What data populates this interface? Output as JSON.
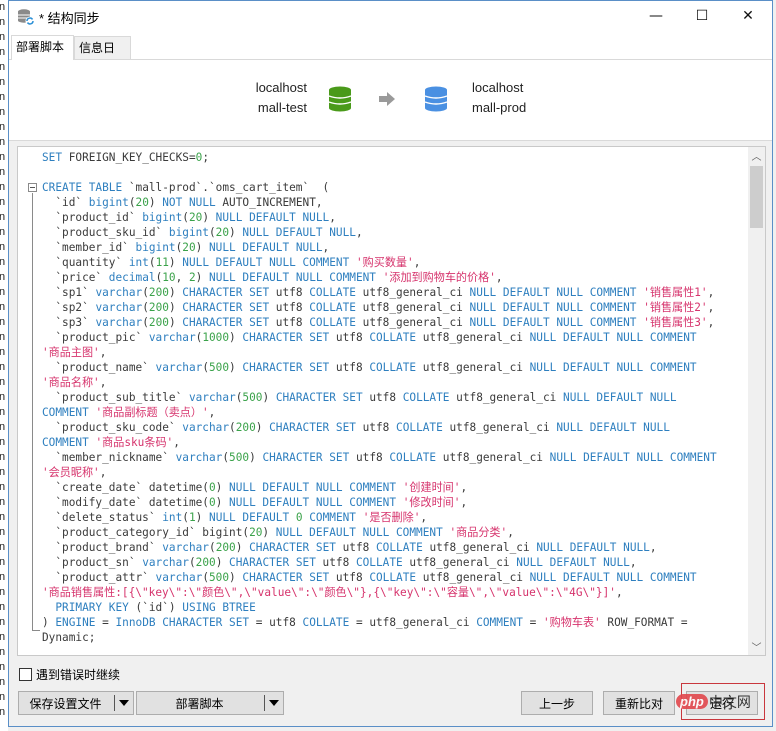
{
  "window": {
    "title": "* 结构同步",
    "icon": "db-sync-icon",
    "controls": {
      "minimize": "—",
      "maximize": "☐",
      "close": "✕"
    }
  },
  "tabs": [
    {
      "label": "部署脚本",
      "active": true
    },
    {
      "label": "信息日志",
      "active": false
    }
  ],
  "sync": {
    "source": {
      "host": "localhost",
      "database": "mall-test",
      "color": "#4a9a1a"
    },
    "target": {
      "host": "localhost",
      "database": "mall-prod",
      "color": "#4a90e2"
    },
    "arrow_color": "#9a9a9a"
  },
  "script": {
    "lines": [
      [
        [
          "kw",
          "SET"
        ],
        [
          "p",
          " FOREIGN_KEY_CHECKS="
        ],
        [
          "n",
          "0"
        ],
        [
          "p",
          ";"
        ]
      ],
      [],
      [
        [
          "kw",
          "CREATE TABLE"
        ],
        [
          "p",
          " `mall-prod`.`oms_cart_item`  ("
        ]
      ],
      [
        [
          "p",
          "  `id` "
        ],
        [
          "kw",
          "bigint"
        ],
        [
          "p",
          "("
        ],
        [
          "n",
          "20"
        ],
        [
          "p",
          ") "
        ],
        [
          "kw",
          "NOT NULL"
        ],
        [
          "p",
          " AUTO_INCREMENT,"
        ]
      ],
      [
        [
          "p",
          "  `product_id` "
        ],
        [
          "kw",
          "bigint"
        ],
        [
          "p",
          "("
        ],
        [
          "n",
          "20"
        ],
        [
          "p",
          ") "
        ],
        [
          "kw",
          "NULL DEFAULT NULL"
        ],
        [
          "p",
          ","
        ]
      ],
      [
        [
          "p",
          "  `product_sku_id` "
        ],
        [
          "kw",
          "bigint"
        ],
        [
          "p",
          "("
        ],
        [
          "n",
          "20"
        ],
        [
          "p",
          ") "
        ],
        [
          "kw",
          "NULL DEFAULT NULL"
        ],
        [
          "p",
          ","
        ]
      ],
      [
        [
          "p",
          "  `member_id` "
        ],
        [
          "kw",
          "bigint"
        ],
        [
          "p",
          "("
        ],
        [
          "n",
          "20"
        ],
        [
          "p",
          ") "
        ],
        [
          "kw",
          "NULL DEFAULT NULL"
        ],
        [
          "p",
          ","
        ]
      ],
      [
        [
          "p",
          "  `quantity` "
        ],
        [
          "kw",
          "int"
        ],
        [
          "p",
          "("
        ],
        [
          "n",
          "11"
        ],
        [
          "p",
          ") "
        ],
        [
          "kw",
          "NULL DEFAULT NULL COMMENT"
        ],
        [
          "p",
          " "
        ],
        [
          "s",
          "'购买数量'"
        ],
        [
          "p",
          ","
        ]
      ],
      [
        [
          "p",
          "  `price` "
        ],
        [
          "kw",
          "decimal"
        ],
        [
          "p",
          "("
        ],
        [
          "n",
          "10"
        ],
        [
          "p",
          ", "
        ],
        [
          "n",
          "2"
        ],
        [
          "p",
          ") "
        ],
        [
          "kw",
          "NULL DEFAULT NULL COMMENT"
        ],
        [
          "p",
          " "
        ],
        [
          "s",
          "'添加到购物车的价格'"
        ],
        [
          "p",
          ","
        ]
      ],
      [
        [
          "p",
          "  `sp1` "
        ],
        [
          "kw",
          "varchar"
        ],
        [
          "p",
          "("
        ],
        [
          "n",
          "200"
        ],
        [
          "p",
          ") "
        ],
        [
          "kw",
          "CHARACTER SET"
        ],
        [
          "p",
          " utf8 "
        ],
        [
          "kw",
          "COLLATE"
        ],
        [
          "p",
          " utf8_general_ci "
        ],
        [
          "kw",
          "NULL DEFAULT NULL COMMENT"
        ],
        [
          "p",
          " "
        ],
        [
          "s",
          "'销售属性1'"
        ],
        [
          "p",
          ","
        ]
      ],
      [
        [
          "p",
          "  `sp2` "
        ],
        [
          "kw",
          "varchar"
        ],
        [
          "p",
          "("
        ],
        [
          "n",
          "200"
        ],
        [
          "p",
          ") "
        ],
        [
          "kw",
          "CHARACTER SET"
        ],
        [
          "p",
          " utf8 "
        ],
        [
          "kw",
          "COLLATE"
        ],
        [
          "p",
          " utf8_general_ci "
        ],
        [
          "kw",
          "NULL DEFAULT NULL COMMENT"
        ],
        [
          "p",
          " "
        ],
        [
          "s",
          "'销售属性2'"
        ],
        [
          "p",
          ","
        ]
      ],
      [
        [
          "p",
          "  `sp3` "
        ],
        [
          "kw",
          "varchar"
        ],
        [
          "p",
          "("
        ],
        [
          "n",
          "200"
        ],
        [
          "p",
          ") "
        ],
        [
          "kw",
          "CHARACTER SET"
        ],
        [
          "p",
          " utf8 "
        ],
        [
          "kw",
          "COLLATE"
        ],
        [
          "p",
          " utf8_general_ci "
        ],
        [
          "kw",
          "NULL DEFAULT NULL COMMENT"
        ],
        [
          "p",
          " "
        ],
        [
          "s",
          "'销售属性3'"
        ],
        [
          "p",
          ","
        ]
      ],
      [
        [
          "p",
          "  `product_pic` "
        ],
        [
          "kw",
          "varchar"
        ],
        [
          "p",
          "("
        ],
        [
          "n",
          "1000"
        ],
        [
          "p",
          ") "
        ],
        [
          "kw",
          "CHARACTER SET"
        ],
        [
          "p",
          " utf8 "
        ],
        [
          "kw",
          "COLLATE"
        ],
        [
          "p",
          " utf8_general_ci "
        ],
        [
          "kw",
          "NULL DEFAULT NULL COMMENT"
        ]
      ],
      [
        [
          "s",
          "'商品主图'"
        ],
        [
          "p",
          ","
        ]
      ],
      [
        [
          "p",
          "  `product_name` "
        ],
        [
          "kw",
          "varchar"
        ],
        [
          "p",
          "("
        ],
        [
          "n",
          "500"
        ],
        [
          "p",
          ") "
        ],
        [
          "kw",
          "CHARACTER SET"
        ],
        [
          "p",
          " utf8 "
        ],
        [
          "kw",
          "COLLATE"
        ],
        [
          "p",
          " utf8_general_ci "
        ],
        [
          "kw",
          "NULL DEFAULT NULL COMMENT"
        ]
      ],
      [
        [
          "s",
          "'商品名称'"
        ],
        [
          "p",
          ","
        ]
      ],
      [
        [
          "p",
          "  `product_sub_title` "
        ],
        [
          "kw",
          "varchar"
        ],
        [
          "p",
          "("
        ],
        [
          "n",
          "500"
        ],
        [
          "p",
          ") "
        ],
        [
          "kw",
          "CHARACTER SET"
        ],
        [
          "p",
          " utf8 "
        ],
        [
          "kw",
          "COLLATE"
        ],
        [
          "p",
          " utf8_general_ci "
        ],
        [
          "kw",
          "NULL DEFAULT NULL"
        ]
      ],
      [
        [
          "kw",
          "COMMENT"
        ],
        [
          "p",
          " "
        ],
        [
          "s",
          "'商品副标题（卖点）'"
        ],
        [
          "p",
          ","
        ]
      ],
      [
        [
          "p",
          "  `product_sku_code` "
        ],
        [
          "kw",
          "varchar"
        ],
        [
          "p",
          "("
        ],
        [
          "n",
          "200"
        ],
        [
          "p",
          ") "
        ],
        [
          "kw",
          "CHARACTER SET"
        ],
        [
          "p",
          " utf8 "
        ],
        [
          "kw",
          "COLLATE"
        ],
        [
          "p",
          " utf8_general_ci "
        ],
        [
          "kw",
          "NULL DEFAULT NULL"
        ]
      ],
      [
        [
          "kw",
          "COMMENT"
        ],
        [
          "p",
          " "
        ],
        [
          "s",
          "'商品sku条码'"
        ],
        [
          "p",
          ","
        ]
      ],
      [
        [
          "p",
          "  `member_nickname` "
        ],
        [
          "kw",
          "varchar"
        ],
        [
          "p",
          "("
        ],
        [
          "n",
          "500"
        ],
        [
          "p",
          ") "
        ],
        [
          "kw",
          "CHARACTER SET"
        ],
        [
          "p",
          " utf8 "
        ],
        [
          "kw",
          "COLLATE"
        ],
        [
          "p",
          " utf8_general_ci "
        ],
        [
          "kw",
          "NULL DEFAULT NULL COMMENT"
        ]
      ],
      [
        [
          "s",
          "'会员昵称'"
        ],
        [
          "p",
          ","
        ]
      ],
      [
        [
          "p",
          "  `create_date` datetime("
        ],
        [
          "n",
          "0"
        ],
        [
          "p",
          ") "
        ],
        [
          "kw",
          "NULL DEFAULT NULL COMMENT"
        ],
        [
          "p",
          " "
        ],
        [
          "s",
          "'创建时间'"
        ],
        [
          "p",
          ","
        ]
      ],
      [
        [
          "p",
          "  `modify_date` datetime("
        ],
        [
          "n",
          "0"
        ],
        [
          "p",
          ") "
        ],
        [
          "kw",
          "NULL DEFAULT NULL COMMENT"
        ],
        [
          "p",
          " "
        ],
        [
          "s",
          "'修改时间'"
        ],
        [
          "p",
          ","
        ]
      ],
      [
        [
          "p",
          "  `delete_status` "
        ],
        [
          "kw",
          "int"
        ],
        [
          "p",
          "("
        ],
        [
          "n",
          "1"
        ],
        [
          "p",
          ") "
        ],
        [
          "kw",
          "NULL DEFAULT"
        ],
        [
          "p",
          " "
        ],
        [
          "n",
          "0"
        ],
        [
          "p",
          " "
        ],
        [
          "kw",
          "COMMENT"
        ],
        [
          "p",
          " "
        ],
        [
          "s",
          "'是否删除'"
        ],
        [
          "p",
          ","
        ]
      ],
      [
        [
          "p",
          "  `product_category_id` bigint("
        ],
        [
          "n",
          "20"
        ],
        [
          "p",
          ") "
        ],
        [
          "kw",
          "NULL DEFAULT NULL COMMENT"
        ],
        [
          "p",
          " "
        ],
        [
          "s",
          "'商品分类'"
        ],
        [
          "p",
          ","
        ]
      ],
      [
        [
          "p",
          "  `product_brand` "
        ],
        [
          "kw",
          "varchar"
        ],
        [
          "p",
          "("
        ],
        [
          "n",
          "200"
        ],
        [
          "p",
          ") "
        ],
        [
          "kw",
          "CHARACTER SET"
        ],
        [
          "p",
          " utf8 "
        ],
        [
          "kw",
          "COLLATE"
        ],
        [
          "p",
          " utf8_general_ci "
        ],
        [
          "kw",
          "NULL DEFAULT NULL"
        ],
        [
          "p",
          ","
        ]
      ],
      [
        [
          "p",
          "  `product_sn` "
        ],
        [
          "kw",
          "varchar"
        ],
        [
          "p",
          "("
        ],
        [
          "n",
          "200"
        ],
        [
          "p",
          ") "
        ],
        [
          "kw",
          "CHARACTER SET"
        ],
        [
          "p",
          " utf8 "
        ],
        [
          "kw",
          "COLLATE"
        ],
        [
          "p",
          " utf8_general_ci "
        ],
        [
          "kw",
          "NULL DEFAULT NULL"
        ],
        [
          "p",
          ","
        ]
      ],
      [
        [
          "p",
          "  `product_attr` "
        ],
        [
          "kw",
          "varchar"
        ],
        [
          "p",
          "("
        ],
        [
          "n",
          "500"
        ],
        [
          "p",
          ") "
        ],
        [
          "kw",
          "CHARACTER SET"
        ],
        [
          "p",
          " utf8 "
        ],
        [
          "kw",
          "COLLATE"
        ],
        [
          "p",
          " utf8_general_ci "
        ],
        [
          "kw",
          "NULL DEFAULT NULL COMMENT"
        ]
      ],
      [
        [
          "s",
          "'商品销售属性:[{\\\"key\\\":\\\"颜色\\\",\\\"value\\\":\\\"颜色\\\"},{\\\"key\\\":\\\"容量\\\",\\\"value\\\":\\\"4G\\\"}]'"
        ],
        [
          "p",
          ","
        ]
      ],
      [
        [
          "p",
          "  "
        ],
        [
          "kw",
          "PRIMARY KEY"
        ],
        [
          "p",
          " (`id`) "
        ],
        [
          "kw",
          "USING BTREE"
        ]
      ],
      [
        [
          "p",
          ") "
        ],
        [
          "kw",
          "ENGINE"
        ],
        [
          "p",
          " = "
        ],
        [
          "kw",
          "InnoDB CHARACTER SET"
        ],
        [
          "p",
          " = utf8 "
        ],
        [
          "kw",
          "COLLATE"
        ],
        [
          "p",
          " = utf8_general_ci "
        ],
        [
          "kw",
          "COMMENT"
        ],
        [
          "p",
          " = "
        ],
        [
          "s",
          "'购物车表'"
        ],
        [
          "p",
          " ROW_FORMAT ="
        ]
      ],
      [
        [
          "p",
          "Dynamic;"
        ]
      ]
    ],
    "colors": {
      "keyword": "#2e7fbf",
      "number": "#3aa24a",
      "string": "#d6336c",
      "plain": "#3b3b3b"
    }
  },
  "options": {
    "continue_on_error_label": "遇到错误时继续",
    "continue_on_error_checked": false
  },
  "buttons": {
    "save_settings": "保存设置文件",
    "deploy_script": "部署脚本",
    "previous": "上一步",
    "recompare": "重新比对",
    "run": "运行"
  },
  "watermark": {
    "brand": "php",
    "text": "中文网"
  },
  "left_strip": {
    "char": "n"
  }
}
